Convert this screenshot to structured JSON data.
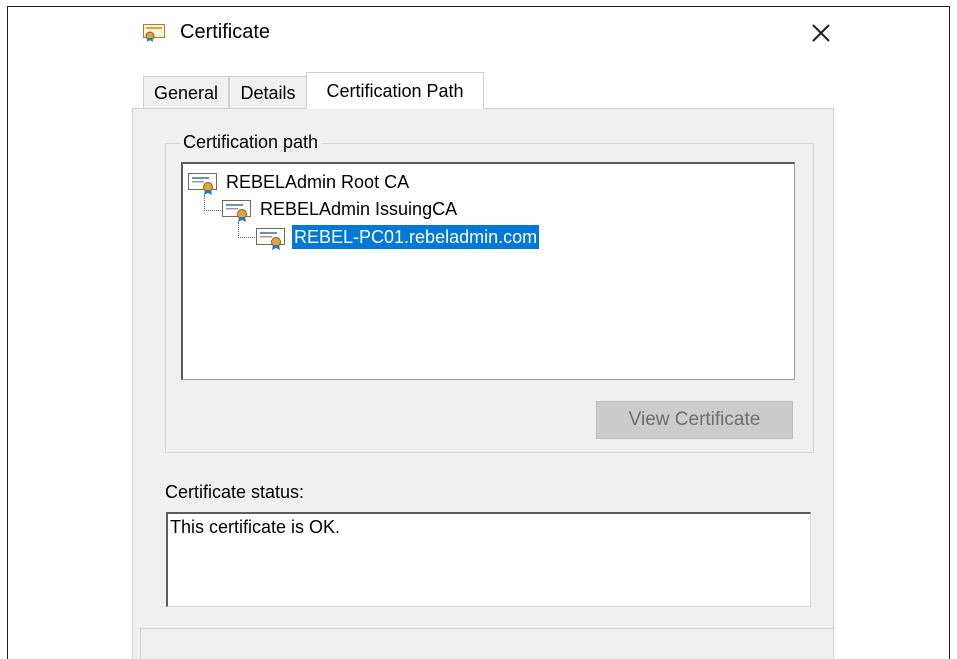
{
  "window": {
    "title": "Certificate",
    "icon": "certificate-icon",
    "close_icon": "close-icon"
  },
  "tabs": [
    {
      "label": "General",
      "active": false
    },
    {
      "label": "Details",
      "active": false
    },
    {
      "label": "Certification Path",
      "active": true
    }
  ],
  "certification_path": {
    "group_label": "Certification path",
    "nodes": [
      {
        "label": "REBELAdmin Root CA",
        "level": 0,
        "selected": false,
        "icon": "certificate-icon"
      },
      {
        "label": "REBELAdmin IssuingCA",
        "level": 1,
        "selected": false,
        "icon": "certificate-icon"
      },
      {
        "label": "REBEL-PC01.rebeladmin.com",
        "level": 2,
        "selected": true,
        "icon": "certificate-icon"
      }
    ],
    "view_button_label": "View Certificate",
    "view_button_enabled": false
  },
  "status": {
    "label": "Certificate status:",
    "text": "This certificate is OK."
  },
  "colors": {
    "selection": "#0078d7",
    "panel_bg": "#f0f0f0",
    "disabled_button_bg": "#cccccc"
  }
}
